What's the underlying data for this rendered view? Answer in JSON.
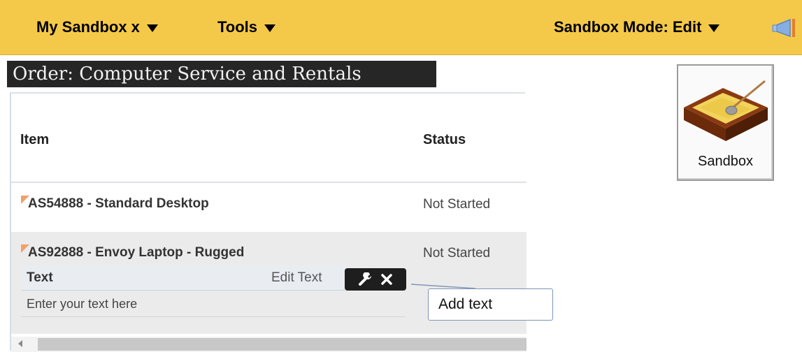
{
  "topbar": {
    "my_sandbox": "My Sandbox x",
    "tools": "Tools",
    "sandbox_mode": "Sandbox Mode: Edit"
  },
  "page": {
    "title": "Order: Computer Service and Rentals"
  },
  "table": {
    "columns": [
      "Item",
      "Status"
    ],
    "rows": [
      {
        "item": "AS54888 - Standard Desktop",
        "status": "Not Started"
      },
      {
        "item": "AS92888 - Envoy Laptop - Rugged",
        "status": "Not Started"
      }
    ]
  },
  "text_component": {
    "title": "Text",
    "edit_label": "Edit Text",
    "placeholder": "Enter your text here"
  },
  "callout": {
    "label": "Add text"
  },
  "sandbox_button": {
    "label": "Sandbox"
  },
  "colors": {
    "topbar": "#f4c94a",
    "title_bg": "#262626",
    "flag": "#f2a06b",
    "callout_border": "#7f96b8"
  },
  "icons": [
    "chevron-down-icon",
    "megaphone-icon",
    "wrench-icon",
    "close-icon",
    "scroll-left-icon",
    "sandbox-icon"
  ]
}
